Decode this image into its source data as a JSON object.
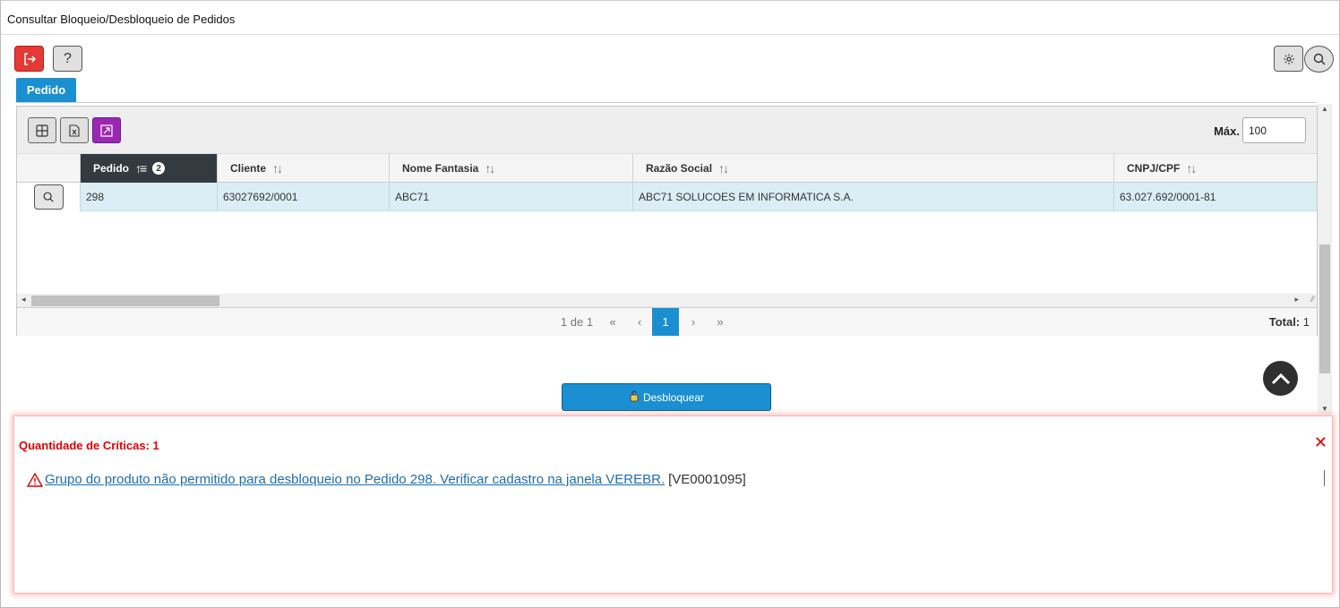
{
  "window": {
    "title": "Consultar Bloqueio/Desbloqueio de Pedidos"
  },
  "toolbar": {
    "exit_icon": "exit-icon",
    "help_label": "?",
    "settings_icon": "gear-icon",
    "search_icon": "search-icon"
  },
  "tabs": [
    {
      "label": "Pedido",
      "active": true
    }
  ],
  "grid": {
    "max_label": "Máx.",
    "max_value": "100",
    "columns": [
      {
        "label": "Pedido",
        "sort_badge": "2",
        "active": true
      },
      {
        "label": "Cliente"
      },
      {
        "label": "Nome Fantasia"
      },
      {
        "label": "Razão Social"
      },
      {
        "label": "CNPJ/CPF"
      }
    ],
    "rows": [
      {
        "pedido": "298",
        "cliente": "63027692/0001",
        "nome_fantasia": "ABC71",
        "razao_social": "ABC71 SOLUCOES EM INFORMATICA S.A.",
        "cnpj": "63.027.692/0001-81"
      }
    ],
    "pager": {
      "page_info": "1 de 1",
      "first": "«",
      "prev": "‹",
      "current": "1",
      "next": "›",
      "last": "»",
      "total_label": "Total:",
      "total_value": "1"
    }
  },
  "actions": {
    "unlock_label": "Desbloquear"
  },
  "criticas": {
    "title": "Quantidade de Críticas: 1",
    "close": "✕",
    "message": "Grupo do produto não permitido para desbloqueio no Pedido 298. Verificar cadastro na janela VEREBR.",
    "code": "[VE0001095]"
  },
  "colors": {
    "accent": "#1a8fd1",
    "danger": "#e53935",
    "purple": "#9c27b0",
    "header_active": "#333a40",
    "row_selected": "#dbeef5"
  }
}
